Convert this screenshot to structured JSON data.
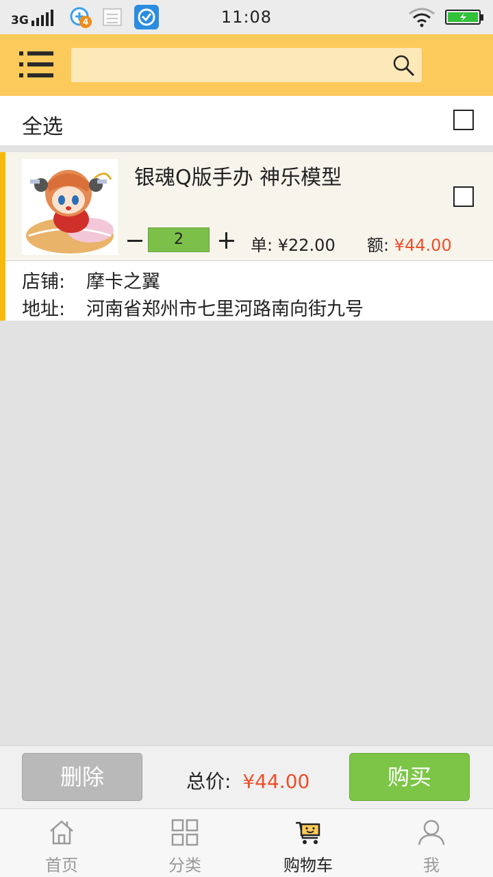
{
  "status_bar": {
    "network": "3G",
    "badge_count": "4",
    "time": "11:08",
    "battery_color": "#32c23a"
  },
  "header": {
    "menu_icon": "menu-list-icon",
    "search_placeholder": "",
    "search_icon": "search-icon",
    "background_color": "#fcca5a"
  },
  "select_all": {
    "label": "全选",
    "checked": false
  },
  "cart_items": [
    {
      "title": "银魂Q版手办 神乐模型",
      "quantity": "2",
      "unit_label": "单:",
      "unit_price": "¥22.00",
      "amount_label": "额:",
      "amount": "¥44.00",
      "shop_label": "店铺:",
      "shop": "摩卡之翼",
      "address_label": "地址:",
      "address": "河南省郑州市七里河路南向街九号",
      "checked": false
    }
  ],
  "action_bar": {
    "delete_label": "删除",
    "total_label": "总价:",
    "total": "¥44.00",
    "buy_label": "购买",
    "price_color": "#ee4e2a",
    "buy_color": "#7cc546"
  },
  "bottom_nav": {
    "items": [
      {
        "label": "首页",
        "icon": "home-icon"
      },
      {
        "label": "分类",
        "icon": "category-grid-icon"
      },
      {
        "label": "购物车",
        "icon": "cart-icon",
        "active": true
      },
      {
        "label": "我",
        "icon": "profile-icon"
      }
    ]
  }
}
